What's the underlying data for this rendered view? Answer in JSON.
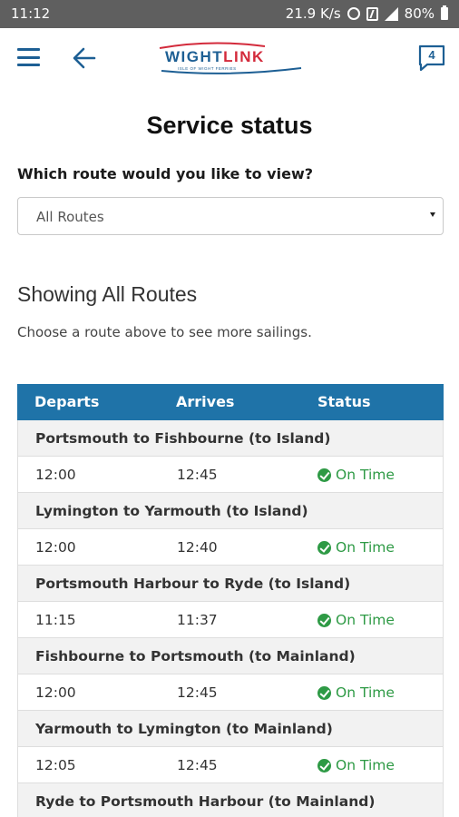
{
  "statusbar": {
    "time": "11:12",
    "net_speed": "21.9 K/s",
    "battery": "80%"
  },
  "header": {
    "logo_primary": "WIGHT",
    "logo_secondary": "LINK",
    "logo_tagline": "ISLE OF WIGHT FERRIES",
    "notification_count": "4"
  },
  "page": {
    "title": "Service status",
    "route_question": "Which route would you like to view?",
    "route_select_value": "All Routes",
    "showing_heading": "Showing All Routes",
    "hint": "Choose a route above to see more sailings."
  },
  "table": {
    "columns": [
      "Departs",
      "Arrives",
      "Status"
    ],
    "routes": [
      {
        "name": "Portsmouth to Fishbourne (to Island)",
        "departs": "12:00",
        "arrives": "12:45",
        "status": "On Time"
      },
      {
        "name": "Lymington to Yarmouth (to Island)",
        "departs": "12:00",
        "arrives": "12:40",
        "status": "On Time"
      },
      {
        "name": "Portsmouth Harbour to Ryde (to Island)",
        "departs": "11:15",
        "arrives": "11:37",
        "status": "On Time"
      },
      {
        "name": "Fishbourne to Portsmouth (to Mainland)",
        "departs": "12:00",
        "arrives": "12:45",
        "status": "On Time"
      },
      {
        "name": "Yarmouth to Lymington (to Mainland)",
        "departs": "12:05",
        "arrives": "12:45",
        "status": "On Time"
      },
      {
        "name": "Ryde to Portsmouth Harbour (to Mainland)"
      }
    ]
  },
  "colors": {
    "brand_blue": "#1d5f94",
    "brand_red": "#d32a3b",
    "table_header": "#1f73a8",
    "status_ok": "#2e9a45"
  }
}
